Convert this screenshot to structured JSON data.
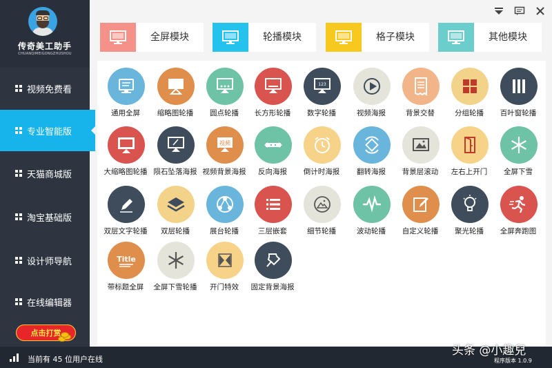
{
  "app": {
    "logo_title": "传奇美工助手",
    "logo_subtitle": "CHUANQIMEIGONGZHUSHOU",
    "donate_label": "点击打赏",
    "online_text": "当前有 45 位用户在线",
    "watermark": "头条 @小趣兒",
    "version": "程序版本 1.0.9"
  },
  "sidebar": {
    "items": [
      {
        "label": "视频免费看",
        "active": false
      },
      {
        "label": "专业智能版",
        "active": true
      },
      {
        "label": "天猫商城版",
        "active": false
      },
      {
        "label": "淘宝基础版",
        "active": false
      },
      {
        "label": "设计师导航",
        "active": false
      },
      {
        "label": "在线编辑器",
        "active": false
      }
    ]
  },
  "categories": [
    {
      "label": "全屏模块",
      "color": "#f49289"
    },
    {
      "label": "轮播模块",
      "color": "#26c2ee"
    },
    {
      "label": "格子模块",
      "color": "#f7c81e"
    },
    {
      "label": "其他模块",
      "color": "#6ccdcd"
    }
  ],
  "modules": [
    {
      "label": "通用全屏",
      "color": "#6ab5dc",
      "icon": "monitor-icon"
    },
    {
      "label": "缩略图轮播",
      "color": "#e08e4c",
      "icon": "thumbnail-icon"
    },
    {
      "label": "圆点轮播",
      "color": "#6ec2a6",
      "icon": "dots-icon"
    },
    {
      "label": "长方形轮播",
      "color": "#d9534f",
      "icon": "rectangle-icon"
    },
    {
      "label": "数字轮播",
      "color": "#3f4c5c",
      "icon": "number-icon"
    },
    {
      "label": "视频海报",
      "color": "#e4e4da",
      "icon": "play-icon"
    },
    {
      "label": "背景交替",
      "color": "#f2b489",
      "icon": "receipt-icon"
    },
    {
      "label": "分组轮播",
      "color": "#f3d38a",
      "icon": "grid-icon"
    },
    {
      "label": "百叶窗轮播",
      "color": "#3f4c5c",
      "icon": "blinds-icon"
    },
    {
      "label": "大缩略图轮播",
      "color": "#d9534f",
      "icon": "big-thumbnail-icon"
    },
    {
      "label": "陨石坠落海报",
      "color": "#3f4c5c",
      "icon": "meteor-icon"
    },
    {
      "label": "视频背景海报",
      "color": "#e08e4c",
      "icon": "video-bg-icon"
    },
    {
      "label": "反向海报",
      "color": "#6ec2a6",
      "icon": "reverse-arrows-icon"
    },
    {
      "label": "倒计时海报",
      "color": "#f7d38a",
      "icon": "alarm-clock-icon"
    },
    {
      "label": "翻转海报",
      "color": "#6ab5dc",
      "icon": "flip-icon"
    },
    {
      "label": "背景层滚动",
      "color": "#e4e4da",
      "icon": "image-frame-icon"
    },
    {
      "label": "左右上开门",
      "color": "#f7d38a",
      "icon": "door-icon"
    },
    {
      "label": "全屏下雪",
      "color": "#6ec2a6",
      "icon": "snowflake-icon"
    },
    {
      "label": "双层文字轮播",
      "color": "#3f4c5c",
      "icon": "pencil-icon"
    },
    {
      "label": "双层轮播",
      "color": "#f3d38a",
      "icon": "layers-icon"
    },
    {
      "label": "展台轮播",
      "color": "#6ab5dc",
      "icon": "share-nodes-icon"
    },
    {
      "label": "三层嵌套",
      "color": "#d9534f",
      "icon": "list-icon"
    },
    {
      "label": "细节轮播",
      "color": "#e4e4da",
      "icon": "photo-icon"
    },
    {
      "label": "波动轮播",
      "color": "#6ec2a6",
      "icon": "wave-icon"
    },
    {
      "label": "自定义轮播",
      "color": "#e08e4c",
      "icon": "edit-icon"
    },
    {
      "label": "聚光轮播",
      "color": "#3f4c5c",
      "icon": "bulb-icon"
    },
    {
      "label": "全屏奔跑图",
      "color": "#d9534f",
      "icon": "runner-icon"
    },
    {
      "label": "带标题全屏",
      "color": "#e08e4c",
      "icon": "title-icon",
      "icon_text": "Title"
    },
    {
      "label": "全屏下雪轮播",
      "color": "#e4e4da",
      "icon": "snowflake-gray-icon"
    },
    {
      "label": "开门特效",
      "color": "#f7d38a",
      "icon": "door-open-icon"
    },
    {
      "label": "固定背景海报",
      "color": "#3f4c5c",
      "icon": "pin-icon"
    }
  ]
}
